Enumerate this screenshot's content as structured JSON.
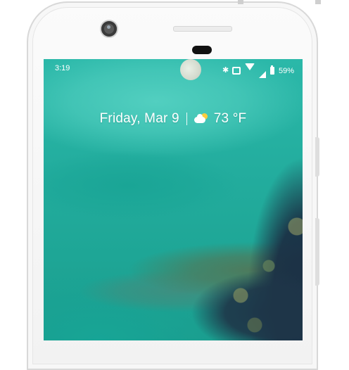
{
  "status_bar": {
    "time": "3:19",
    "battery_percent": "59%",
    "icons": [
      "bluetooth-icon",
      "vibrate-icon",
      "wifi-icon",
      "signal-icon",
      "battery-icon"
    ]
  },
  "glance": {
    "date": "Friday, Mar 9",
    "weather_icon": "partly-cloudy-icon",
    "temperature": "73 °F"
  },
  "colors": {
    "wallpaper_accent": "#23ad9e",
    "text": "#ffffff"
  }
}
